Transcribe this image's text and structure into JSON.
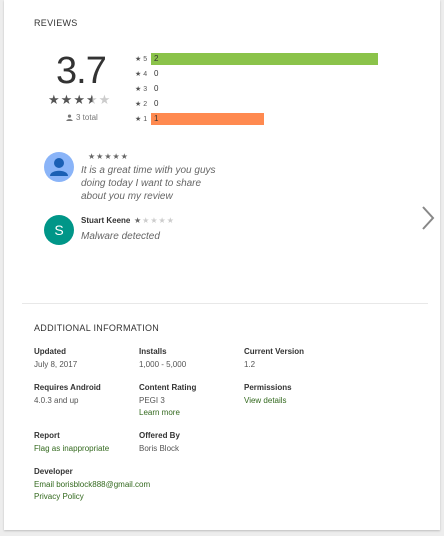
{
  "reviews": {
    "title": "REVIEWS",
    "average": "3.7",
    "average_stars": [
      "full",
      "full",
      "full",
      "half",
      "empty"
    ],
    "total_label": "3 total",
    "histogram": [
      {
        "star": "5",
        "count": "2",
        "fraction": 1.0,
        "color": "#8bc34a"
      },
      {
        "star": "4",
        "count": "0",
        "fraction": 0,
        "color": "#8bc34a"
      },
      {
        "star": "3",
        "count": "0",
        "fraction": 0,
        "color": "#cddc39"
      },
      {
        "star": "2",
        "count": "0",
        "fraction": 0,
        "color": "#ffb74d"
      },
      {
        "star": "1",
        "count": "1",
        "fraction": 0.5,
        "color": "#ff8a50"
      }
    ],
    "items": [
      {
        "author": "",
        "stars": 5,
        "text_lines": [
          "It is a great time with you guys",
          "doing today I want to share",
          "about you my review"
        ],
        "avatar_type": "person",
        "avatar_color": "#8ab4f8"
      },
      {
        "author": "Stuart Keene",
        "stars": 1,
        "text_lines": [
          "Malware detected"
        ],
        "avatar_type": "letter",
        "avatar_letter": "S",
        "avatar_color": "#009688"
      }
    ]
  },
  "additional_info": {
    "title": "ADDITIONAL INFORMATION",
    "updated_label": "Updated",
    "updated_value": "July 8, 2017",
    "installs_label": "Installs",
    "installs_value": "1,000 - 5,000",
    "version_label": "Current Version",
    "version_value": "1.2",
    "requires_label": "Requires Android",
    "requires_value": "4.0.3 and up",
    "content_rating_label": "Content Rating",
    "content_rating_value": "PEGI 3",
    "learn_more": "Learn more",
    "permissions_label": "Permissions",
    "view_details": "View details",
    "report_label": "Report",
    "flag_link": "Flag as inappropriate",
    "offered_label": "Offered By",
    "offered_value": "Boris Block",
    "developer_label": "Developer",
    "email_link": "Email borisblock888@gmail.com",
    "privacy_link": "Privacy Policy"
  },
  "colors": {
    "link": "#33691e",
    "bar_5": "#8bc34a",
    "bar_1": "#ff8a50"
  }
}
